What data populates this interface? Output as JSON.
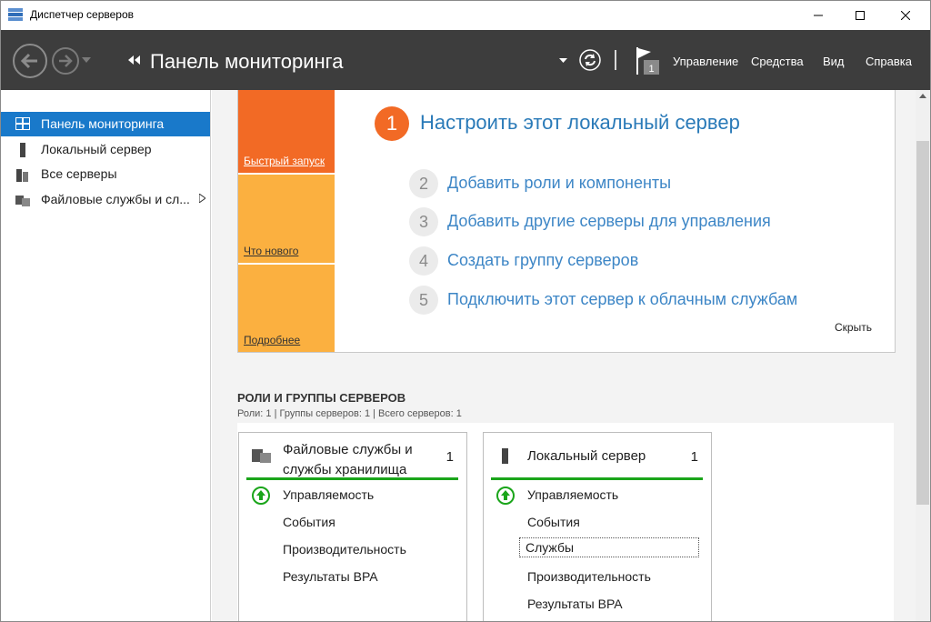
{
  "window": {
    "title": "Диспетчер серверов"
  },
  "header": {
    "page_title": "Панель мониторинга",
    "flag_badge": "1",
    "menu": [
      "Управление",
      "Средства",
      "Вид",
      "Справка"
    ]
  },
  "sidebar": {
    "items": [
      {
        "label": "Панель мониторинга",
        "icon": "dashboard-icon",
        "active": true
      },
      {
        "label": "Локальный сервер",
        "icon": "server-icon"
      },
      {
        "label": "Все серверы",
        "icon": "servers-icon"
      },
      {
        "label": "Файловые службы и сл...",
        "icon": "file-services-icon"
      }
    ]
  },
  "quick_start": {
    "tiles": [
      "Быстрый запуск",
      "Что нового",
      "Подробнее"
    ],
    "step1": {
      "num": "1",
      "text": "Настроить этот локальный сервер"
    },
    "steps": [
      {
        "num": "2",
        "text": "Добавить роли и компоненты"
      },
      {
        "num": "3",
        "text": "Добавить другие серверы для управления"
      },
      {
        "num": "4",
        "text": "Создать группу серверов"
      },
      {
        "num": "5",
        "text": "Подключить этот сервер к облачным службам"
      }
    ],
    "hide": "Скрыть"
  },
  "roles": {
    "title": "РОЛИ И ГРУППЫ СЕРВЕРОВ",
    "subtitle": "Роли: 1 | Группы серверов: 1 | Всего серверов: 1",
    "cards": [
      {
        "title": "Файловые службы и службы хранилища",
        "count": "1",
        "rows": [
          "Управляемость",
          "События",
          "Производительность",
          "Результаты BPA"
        ]
      },
      {
        "title": "Локальный сервер",
        "count": "1",
        "rows": [
          "Управляемость",
          "События",
          "Службы",
          "Производительность",
          "Результаты BPA"
        ]
      }
    ]
  },
  "colors": {
    "accent": "#1979ca",
    "orange": "#f26a25",
    "amber": "#fbb040",
    "status_ok": "#1aa51a"
  }
}
